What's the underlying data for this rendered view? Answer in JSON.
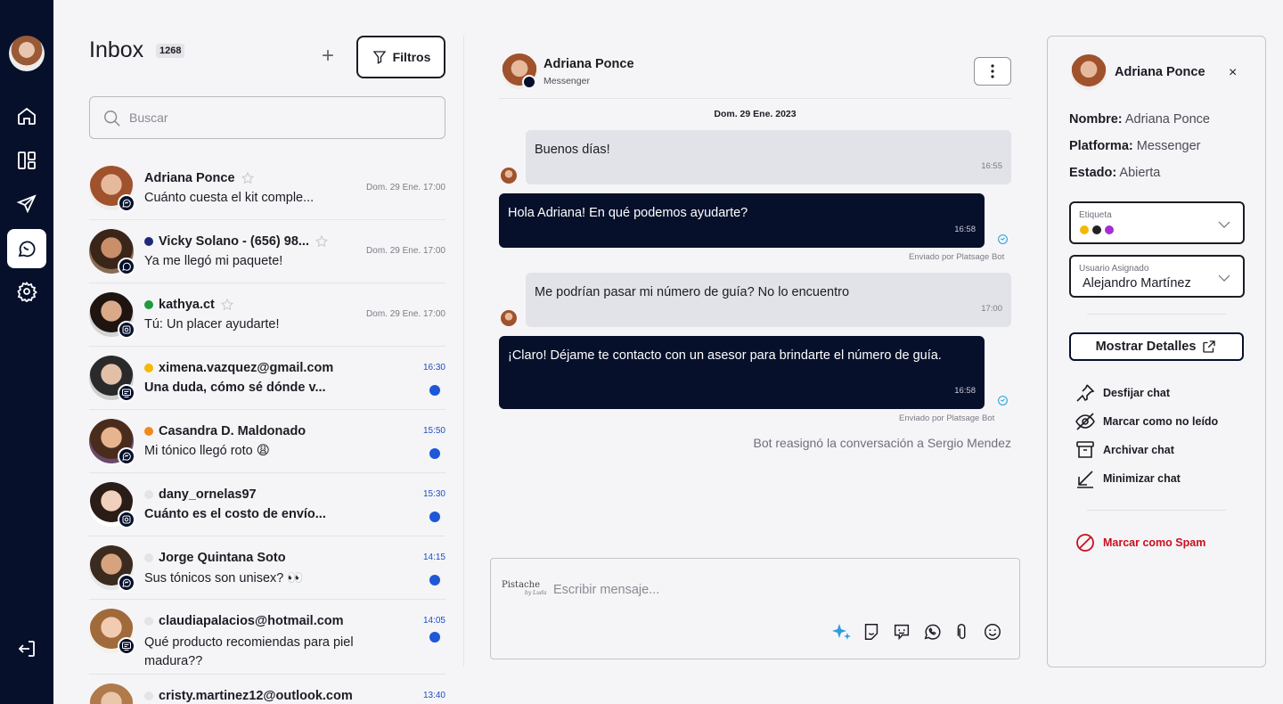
{
  "rail": {
    "items": [
      "home-icon",
      "layout-icon",
      "send-icon",
      "chat-icon",
      "settings-icon",
      "logout-icon"
    ],
    "active": "chat-icon"
  },
  "inbox": {
    "title": "Inbox",
    "count": "1268",
    "filter_label": "Filtros",
    "search_placeholder": "Buscar",
    "conversations": [
      {
        "name": "Adriana Ponce",
        "preview": "Cuánto cuesta el kit comple...",
        "time": "Dom. 29 Ene. 17:00",
        "platform": "messenger",
        "dot": "",
        "unread": false
      },
      {
        "name": "Vicky Solano - (656) 98...",
        "preview": "Ya me llegó mi paquete!",
        "time": "Dom. 29 Ene. 17:00",
        "platform": "whatsapp",
        "dot": "#1e2a78",
        "unread": false
      },
      {
        "name": "kathya.ct",
        "preview": "Tú: Un placer ayudarte!",
        "time": "Dom. 29 Ene. 17:00",
        "platform": "instagram",
        "dot": "#1f9a3c",
        "unread": false
      },
      {
        "name": "ximena.vazquez@gmail.com",
        "preview": "Una duda, cómo sé dónde v...",
        "time": "16:30",
        "platform": "webchat",
        "dot": "#f5b800",
        "unread": true
      },
      {
        "name": "Casandra D. Maldonado",
        "preview": "Mi tónico llegó roto 😩",
        "time": "15:50",
        "platform": "messenger",
        "dot": "#f08a1c",
        "unread": true
      },
      {
        "name": "dany_ornelas97",
        "preview": "Cuánto es el costo de envío...",
        "time": "15:30",
        "platform": "instagram",
        "dot": "#e3e3e8",
        "unread": true
      },
      {
        "name": "Jorge Quintana Soto",
        "preview": "Sus tónicos son unisex? 👀",
        "time": "14:15",
        "platform": "messenger",
        "dot": "#e3e3e8",
        "unread": true
      },
      {
        "name": "claudiapalacios@hotmail.com",
        "preview": "Qué producto recomiendas para piel madura??",
        "time": "14:05",
        "platform": "webchat",
        "dot": "#e3e3e8",
        "unread": true
      },
      {
        "name": "cristy.martinez12@outlook.com",
        "preview": "",
        "time": "13:40",
        "platform": "webchat",
        "dot": "#e3e3e8",
        "unread": true
      }
    ]
  },
  "chat": {
    "name": "Adriana Ponce",
    "platform": "Messenger",
    "date_label": "Dom. 29 Ene. 2023",
    "messages": [
      {
        "dir": "in",
        "text": "Buenos días!",
        "time": "16:55"
      },
      {
        "dir": "out",
        "text": "Hola Adriana! En qué podemos ayudarte?",
        "time": "16:58",
        "sent_by": "Enviado por Platsage Bot"
      },
      {
        "dir": "in",
        "text": "Me podrían pasar mi número de guía? No lo encuentro",
        "time": "17:00"
      },
      {
        "dir": "out",
        "text": "¡Claro! Déjame te contacto con un asesor para brindarte el número de guía.",
        "time": "16:58",
        "sent_by": "Enviado por Platsage Bot"
      }
    ],
    "system_note": "Bot reasignó la conversación a Sergio Mendez",
    "composer": {
      "brand": "Pistache",
      "brand_sub": "by Luda",
      "placeholder": "Escribir mensaje...",
      "tools": [
        "sparkle-icon",
        "sticker-icon",
        "quick-reply-icon",
        "whatsapp-icon",
        "attach-icon",
        "emoji-icon"
      ]
    }
  },
  "panel": {
    "name": "Adriana Ponce",
    "close": "×",
    "nombre_label": "Nombre:",
    "nombre_value": "Adriana Ponce",
    "platform_label": "Platforma:",
    "platform_value": "Messenger",
    "estado_label": "Estado:",
    "estado_value": "Abierta",
    "etiqueta_label": "Etiqueta",
    "etiqueta_colors": [
      "#f5b800",
      "#222222",
      "#a32fd1"
    ],
    "usuario_label": "Usuario Asignado",
    "usuario_value": "Alejandro Martínez",
    "details_label": "Mostrar Detalles",
    "actions": [
      {
        "label": "Desfijar chat",
        "icon": "pin-icon"
      },
      {
        "label": "Marcar como no leído",
        "icon": "eye-off-icon"
      },
      {
        "label": "Archivar chat",
        "icon": "archive-icon"
      },
      {
        "label": "Minimizar chat",
        "icon": "minimize-icon"
      }
    ],
    "spam_label": "Marcar como Spam"
  }
}
